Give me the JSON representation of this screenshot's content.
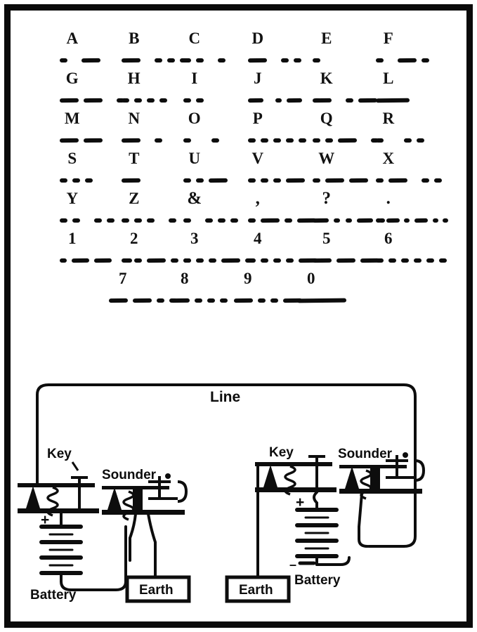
{
  "figure": {
    "title": "American Morse Code chart and telegraph circuit",
    "ink_color": "#0d0d0d",
    "paper_color": "#ffffff"
  },
  "morse_chart": {
    "rows": [
      {
        "cells": [
          {
            "symbol": "A",
            "code": [
              "dot",
              "gap",
              "dash"
            ]
          },
          {
            "symbol": "B",
            "code": [
              "dash",
              "gap",
              "dot",
              "dot",
              "dot"
            ]
          },
          {
            "symbol": "C",
            "code": [
              "dot",
              "dot",
              "gap",
              "dot"
            ]
          },
          {
            "symbol": "D",
            "code": [
              "dash",
              "gap",
              "dot",
              "dot"
            ]
          },
          {
            "symbol": "E",
            "code": [
              "dot"
            ]
          },
          {
            "symbol": "F",
            "code": [
              "dot",
              "gap",
              "dash",
              "dot"
            ]
          }
        ]
      },
      {
        "cells": [
          {
            "symbol": "G",
            "code": [
              "dash",
              "dash",
              "gap",
              "dot"
            ]
          },
          {
            "symbol": "H",
            "code": [
              "dot",
              "dot",
              "dot",
              "dot"
            ]
          },
          {
            "symbol": "I",
            "code": [
              "dot",
              "dot"
            ]
          },
          {
            "symbol": "J",
            "code": [
              "dash",
              "gap",
              "dot",
              "dash",
              "gap",
              "dot"
            ]
          },
          {
            "symbol": "K",
            "code": [
              "dash",
              "gap",
              "dot",
              "dash"
            ]
          },
          {
            "symbol": "L",
            "code": [
              "longdash"
            ]
          }
        ]
      },
      {
        "cells": [
          {
            "symbol": "M",
            "code": [
              "dash",
              "dash"
            ]
          },
          {
            "symbol": "N",
            "code": [
              "dash",
              "gap",
              "dot"
            ]
          },
          {
            "symbol": "O",
            "code": [
              "dot",
              "gap2",
              "dot"
            ]
          },
          {
            "symbol": "P",
            "code": [
              "dot",
              "dot",
              "dot",
              "dot",
              "dot"
            ]
          },
          {
            "symbol": "Q",
            "code": [
              "dot",
              "dot",
              "dash",
              "gap",
              "dot"
            ]
          },
          {
            "symbol": "R",
            "code": [
              "dot",
              "gap2",
              "dot",
              "dot"
            ]
          }
        ]
      },
      {
        "cells": [
          {
            "symbol": "S",
            "code": [
              "dot",
              "dot",
              "dot"
            ]
          },
          {
            "symbol": "T",
            "code": [
              "dash"
            ]
          },
          {
            "symbol": "U",
            "code": [
              "dot",
              "dot",
              "dash"
            ]
          },
          {
            "symbol": "V",
            "code": [
              "dot",
              "dot",
              "dot",
              "dash"
            ]
          },
          {
            "symbol": "W",
            "code": [
              "dot",
              "dash",
              "dash"
            ]
          },
          {
            "symbol": "X",
            "code": [
              "dot",
              "dash",
              "gap",
              "dot",
              "dot"
            ]
          }
        ]
      },
      {
        "cells": [
          {
            "symbol": "Y",
            "code": [
              "dot",
              "dot",
              "gap",
              "dot",
              "dot"
            ]
          },
          {
            "symbol": "Z",
            "code": [
              "dot",
              "dot",
              "dot",
              "gap",
              "dot"
            ]
          },
          {
            "symbol": "&",
            "code": [
              "dot",
              "gap",
              "dot",
              "dot",
              "dot"
            ]
          },
          {
            "symbol": ",",
            "code": [
              "dot",
              "dash",
              "dot",
              "dash"
            ]
          },
          {
            "symbol": "?",
            "code": [
              "dash",
              "dot",
              "dot",
              "dash",
              "dot"
            ]
          },
          {
            "symbol": ".",
            "code": [
              "dot",
              "dash",
              "dot",
              "dash",
              "dot",
              "dot"
            ]
          }
        ]
      },
      {
        "cells": [
          {
            "symbol": "1",
            "code": [
              "dot",
              "dash",
              "dash",
              "gap",
              "dot"
            ]
          },
          {
            "symbol": "2",
            "code": [
              "dot",
              "dot",
              "dash",
              "dot",
              "dot"
            ]
          },
          {
            "symbol": "3",
            "code": [
              "dot",
              "dot",
              "dot",
              "dash",
              "dot"
            ]
          },
          {
            "symbol": "4",
            "code": [
              "dot",
              "dot",
              "dot",
              "dot",
              "dash"
            ]
          },
          {
            "symbol": "5",
            "code": [
              "dash",
              "dash",
              "dash"
            ]
          },
          {
            "symbol": "6",
            "code": [
              "dot",
              "dot",
              "dot",
              "dot",
              "dot",
              "dot"
            ]
          }
        ]
      }
    ],
    "second_number_row": {
      "cells": [
        {
          "symbol": "7",
          "code": [
            "dash",
            "dash",
            "dot",
            "dot"
          ]
        },
        {
          "symbol": "8",
          "code": [
            "dash",
            "dot",
            "dot",
            "dot"
          ]
        },
        {
          "symbol": "9",
          "code": [
            "dash",
            "dot",
            "dot",
            "dash"
          ]
        },
        {
          "symbol": "0",
          "code": [
            "xlongdash"
          ]
        }
      ]
    }
  },
  "circuit": {
    "line_label": "Line",
    "left_station": {
      "key_label": "Key",
      "sounder_label": "Sounder",
      "battery_label": "Battery",
      "battery_plus": "+",
      "earth_label": "Earth"
    },
    "right_station": {
      "key_label": "Key",
      "sounder_label": "Sounder",
      "battery_label": "Battery",
      "battery_plus": "+",
      "battery_minus": "–",
      "earth_label": "Earth"
    }
  }
}
